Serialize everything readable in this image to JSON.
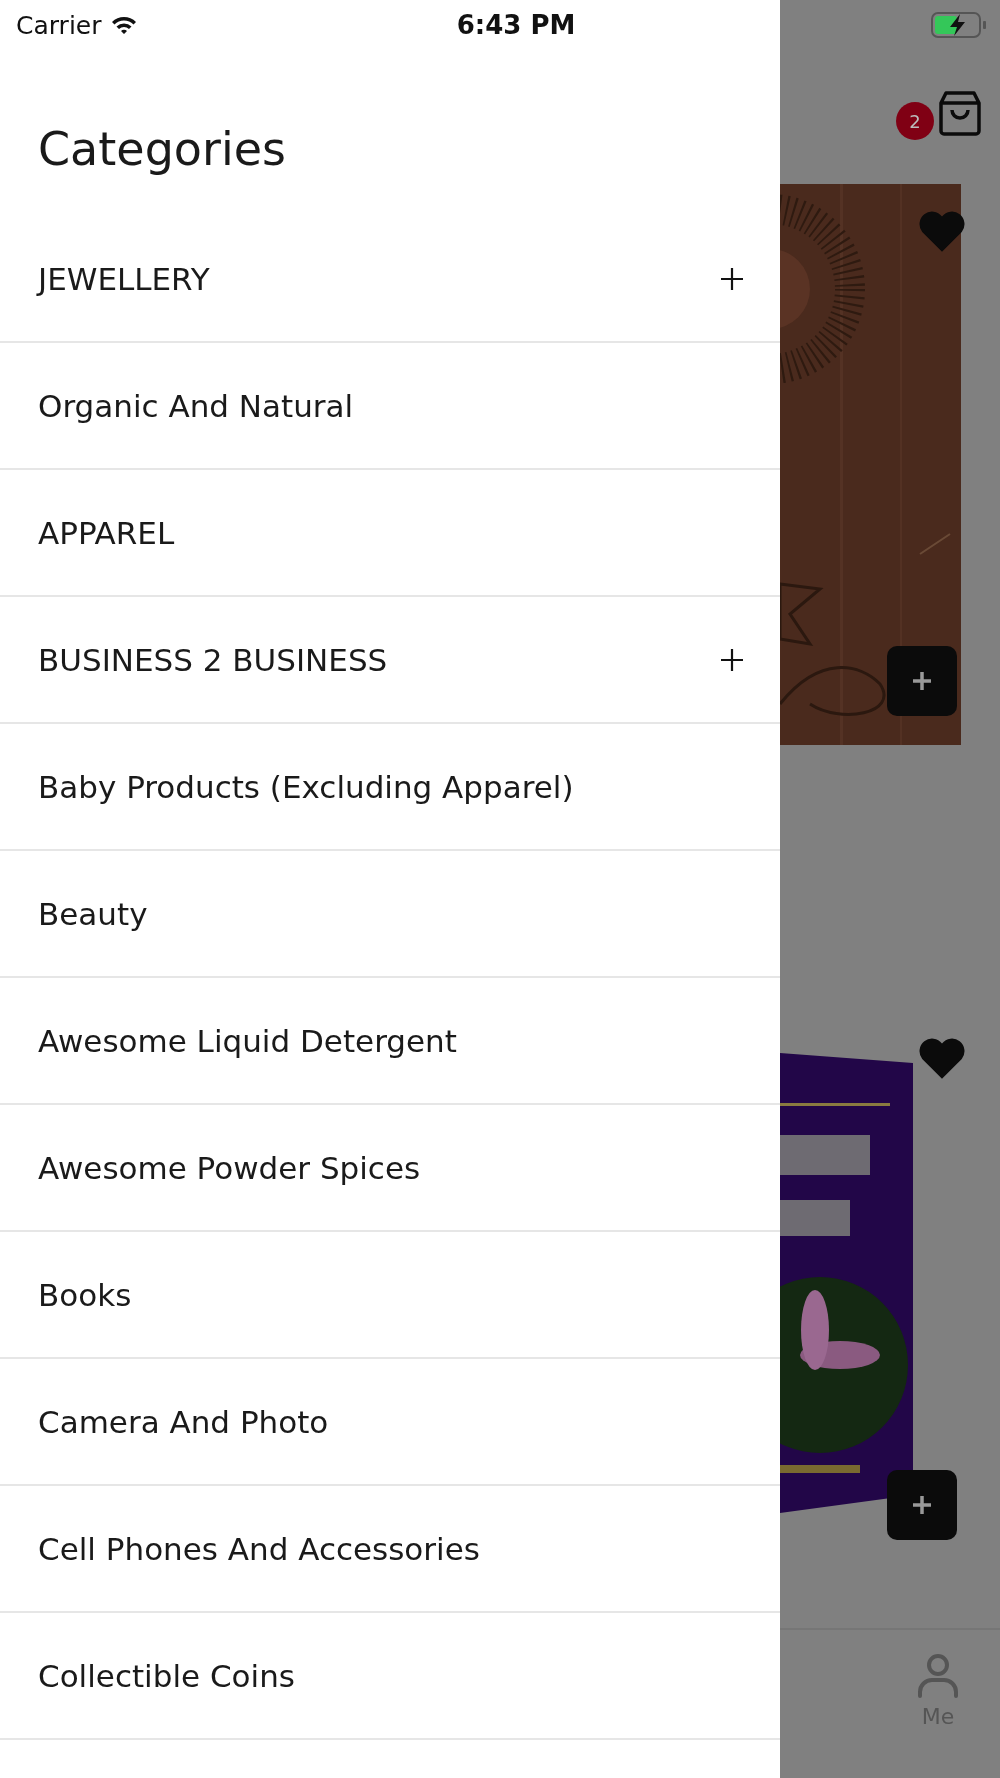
{
  "status_bar": {
    "carrier": "Carrier",
    "time": "6:43 PM"
  },
  "drawer": {
    "title": "Categories",
    "items": [
      {
        "label": "JEWELLERY",
        "expandable": true
      },
      {
        "label": "Organic And Natural",
        "expandable": false
      },
      {
        "label": "APPAREL",
        "expandable": false
      },
      {
        "label": "BUSINESS 2 BUSINESS",
        "expandable": true
      },
      {
        "label": "Baby Products (Excluding Apparel)",
        "expandable": false
      },
      {
        "label": "Beauty",
        "expandable": false
      },
      {
        "label": "Awesome Liquid Detergent",
        "expandable": false
      },
      {
        "label": "Awesome Powder Spices",
        "expandable": false
      },
      {
        "label": "Books",
        "expandable": false
      },
      {
        "label": "Camera And Photo",
        "expandable": false
      },
      {
        "label": "Cell Phones And Accessories",
        "expandable": false
      },
      {
        "label": "Collectible Coins",
        "expandable": false
      }
    ]
  },
  "background": {
    "cart_count": "2",
    "tab_bar": {
      "label": "Me"
    }
  }
}
